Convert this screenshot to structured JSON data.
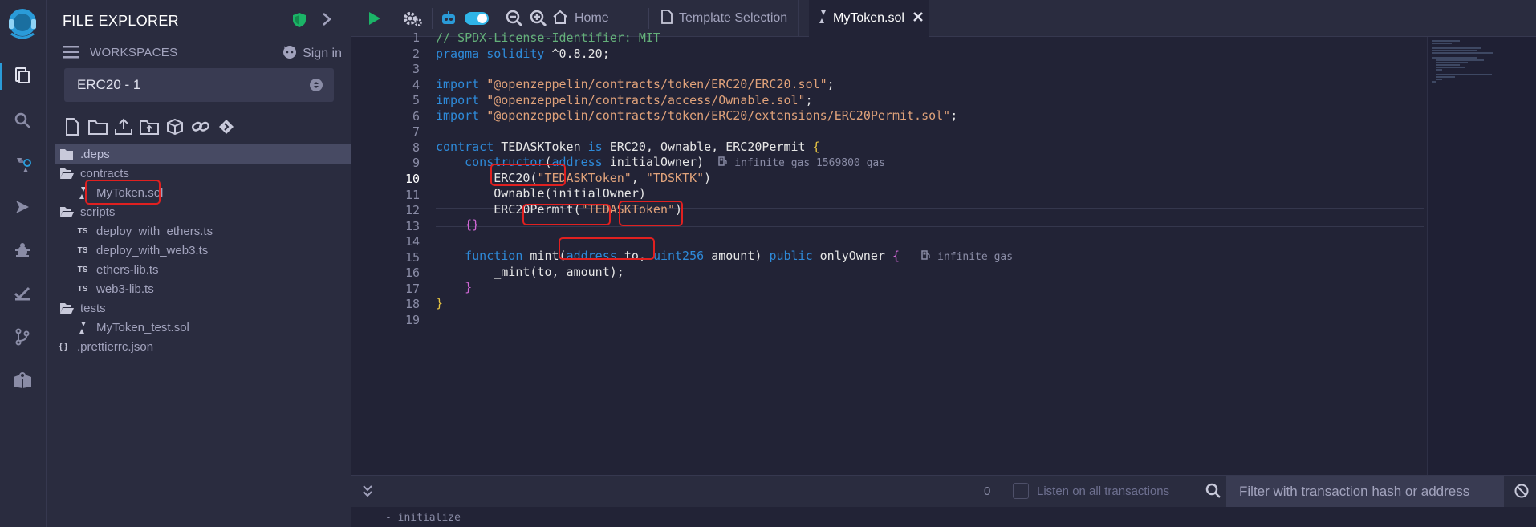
{
  "explorer": {
    "title": "FILE EXPLORER",
    "workspaces_label": "WORKSPACES",
    "sign_in": "Sign in",
    "workspace_selected": "ERC20 - 1",
    "tree": [
      {
        "name": ".deps",
        "type": "folder",
        "depth": 0,
        "selected": true
      },
      {
        "name": "contracts",
        "type": "folder-open",
        "depth": 0
      },
      {
        "name": "MyToken.sol",
        "type": "sol",
        "depth": 1,
        "highlighted": true
      },
      {
        "name": "scripts",
        "type": "folder-open",
        "depth": 0
      },
      {
        "name": "deploy_with_ethers.ts",
        "type": "ts",
        "depth": 1
      },
      {
        "name": "deploy_with_web3.ts",
        "type": "ts",
        "depth": 1
      },
      {
        "name": "ethers-lib.ts",
        "type": "ts",
        "depth": 1
      },
      {
        "name": "web3-lib.ts",
        "type": "ts",
        "depth": 1
      },
      {
        "name": "tests",
        "type": "folder-open",
        "depth": 0
      },
      {
        "name": "MyToken_test.sol",
        "type": "sol",
        "depth": 1
      },
      {
        "name": ".prettierrc.json",
        "type": "json",
        "depth": 0
      }
    ]
  },
  "topbar": {
    "home_label": "Home",
    "tabs": [
      {
        "label": "Template Selection",
        "active": false
      },
      {
        "label": "MyToken.sol",
        "active": true
      }
    ]
  },
  "editor": {
    "current_line": 10,
    "line_numbers": [
      "1",
      "2",
      "3",
      "4",
      "5",
      "6",
      "7",
      "8",
      "9",
      "10",
      "11",
      "12",
      "13",
      "14",
      "15",
      "16",
      "17",
      "18",
      "19"
    ],
    "gas_constructor": "infinite gas 1569800 gas",
    "gas_mint": "infinite gas",
    "code": {
      "l1": "// SPDX-License-Identifier: MIT",
      "pragma": "pragma",
      "solidity": "solidity",
      "version": "^0.8.20;",
      "import": "import",
      "imp1": "\"@openzeppelin/contracts/token/ERC20/ERC20.sol\"",
      "imp2": "\"@openzeppelin/contracts/access/Ownable.sol\"",
      "imp3": "\"@openzeppelin/contracts/token/ERC20/extensions/ERC20Permit.sol\"",
      "contract": "contract",
      "contract_name": "TEDASKToken",
      "is": "is",
      "bases": "ERC20, Ownable, ERC20Permit",
      "constructor": "constructor",
      "address": "address",
      "initial_owner": "initialOwner",
      "erc20": "ERC20",
      "token_name": "\"TEDASKToken\"",
      "token_symbol": "\"TDSKTK\"",
      "ownable": "Ownable",
      "erc20permit": "ERC20Permit",
      "function": "function",
      "mint": "mint",
      "to": "to",
      "uint256": "uint256",
      "amount": "amount",
      "public": "public",
      "only_owner": "onlyOwner",
      "mint_call": "_mint",
      "mint_args": "to, amount"
    }
  },
  "terminal": {
    "count": "0",
    "listen_label": "Listen on all transactions",
    "filter_placeholder": "Filter with transaction hash or address",
    "body_text": "- initialize"
  },
  "colors": {
    "highlight_box": "#e02020",
    "accent": "#2a9bd8",
    "run": "#1bb467"
  }
}
